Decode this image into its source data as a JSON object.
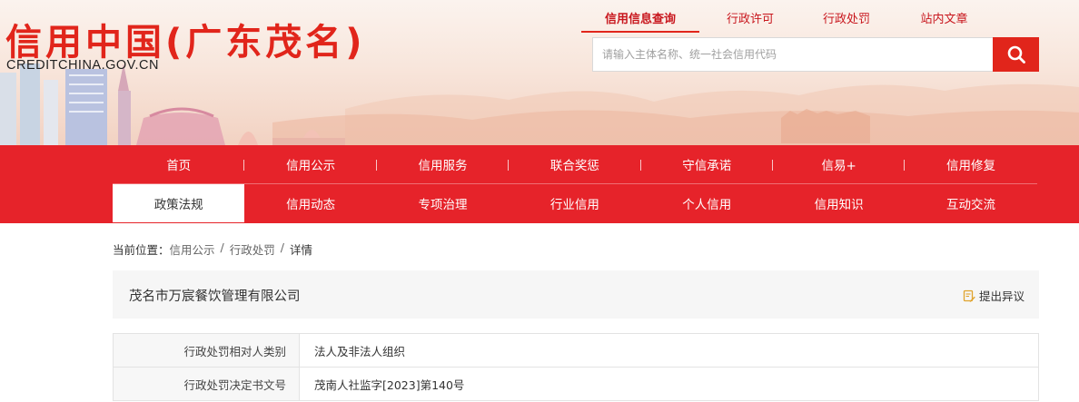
{
  "site": {
    "logo_title": "信用中国(广东茂名)",
    "logo_domain": "CREDITCHINA.GOV.CN"
  },
  "top_links": [
    {
      "label": "信用信息查询",
      "active": true
    },
    {
      "label": "行政许可",
      "active": false
    },
    {
      "label": "行政处罚",
      "active": false
    },
    {
      "label": "站内文章",
      "active": false
    }
  ],
  "search": {
    "placeholder": "请输入主体名称、统一社会信用代码",
    "icon": "search-icon"
  },
  "nav": {
    "row1": [
      "首页",
      "信用公示",
      "信用服务",
      "联合奖惩",
      "守信承诺",
      "信易+",
      "信用修复"
    ],
    "row2": [
      "政策法规",
      "信用动态",
      "专项治理",
      "行业信用",
      "个人信用",
      "信用知识",
      "互动交流"
    ],
    "current": "政策法规"
  },
  "breadcrumb": {
    "prefix": "当前位置：",
    "items": [
      "信用公示",
      "行政处罚",
      "详情"
    ],
    "separator": "/"
  },
  "company": {
    "name": "茂名市万宸餐饮管理有限公司",
    "objection_label": "提出异议",
    "objection_icon": "edit-note-icon"
  },
  "details": [
    {
      "label": "行政处罚相对人类别",
      "value": "法人及非法人组织"
    },
    {
      "label": "行政处罚决定书文号",
      "value": "茂南人社监字[2023]第140号"
    }
  ],
  "colors": {
    "brand_red": "#e1251b",
    "nav_red": "#e6232a"
  }
}
